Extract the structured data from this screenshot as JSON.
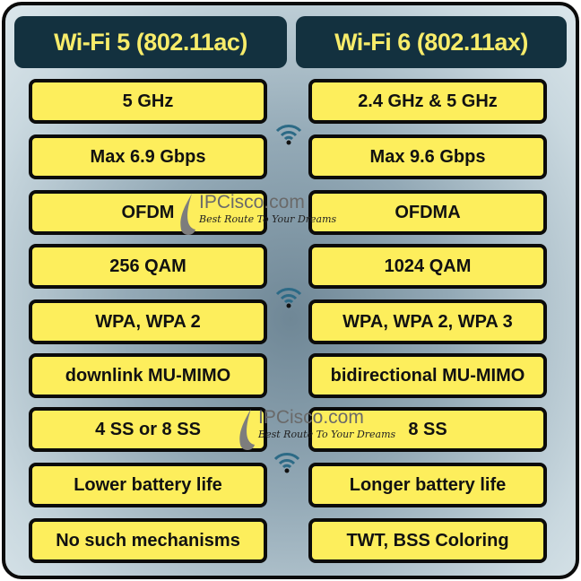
{
  "headers": {
    "left": "Wi-Fi 5 (802.11ac)",
    "right": "Wi-Fi 6 (802.11ax)"
  },
  "rows": [
    {
      "left": "5 GHz",
      "right": "2.4 GHz & 5 GHz"
    },
    {
      "left": "Max 6.9 Gbps",
      "right": "Max 9.6 Gbps"
    },
    {
      "left": "OFDM",
      "right": "OFDMA"
    },
    {
      "left": "256 QAM",
      "right": "1024 QAM"
    },
    {
      "left": "WPA, WPA 2",
      "right": "WPA, WPA 2, WPA 3"
    },
    {
      "left": "downlink MU-MIMO",
      "right": "bidirectional MU-MIMO"
    },
    {
      "left": "4 SS or 8 SS",
      "right": "8 SS"
    },
    {
      "left": "Lower battery life",
      "right": "Longer battery life"
    },
    {
      "left": "No such mechanisms",
      "right": "TWT, BSS Coloring"
    }
  ],
  "watermark": {
    "site": "IPCisco.com",
    "tagline": "Best Route To Your Dreams"
  },
  "colors": {
    "header_bg": "#13313f",
    "header_text": "#f7ec6a",
    "box_fill": "#fdee5c",
    "border": "#0b0b0b"
  },
  "icons": [
    "wifi-icon",
    "logo-drop-icon"
  ]
}
